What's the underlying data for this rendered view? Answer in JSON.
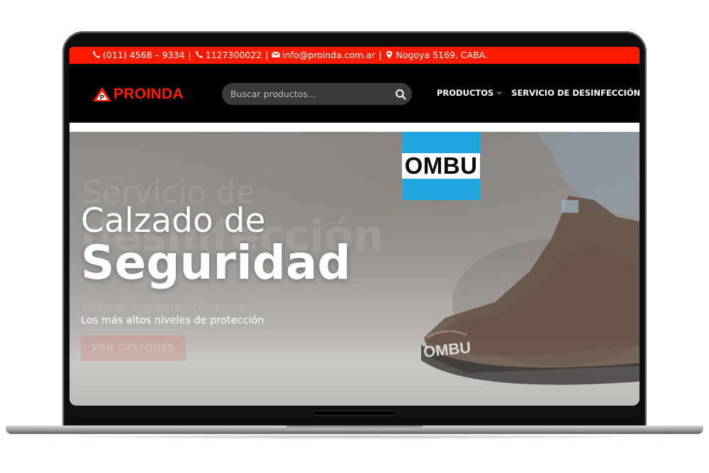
{
  "topbar": {
    "phone1": "(011) 4568 – 9334",
    "phone2": "1127300022",
    "email": "info@proinda.com.ar",
    "address": "Nogoya 5169, CABA.",
    "separator": "|"
  },
  "header": {
    "logo_text": "PROINDA",
    "logo_badge": "P",
    "search_placeholder": "Buscar productos...",
    "menu": [
      {
        "label": "PRODUCTOS",
        "has_dropdown": true
      },
      {
        "label": "SERVICIO DE DESINFECCIÓN",
        "has_dropdown": false
      }
    ]
  },
  "hero": {
    "title_line1": "Calzado de",
    "title_line2": "Seguridad",
    "subtitle": "Los más altos niveles de protección",
    "brand_badge": "OMBU",
    "ghost": {
      "line1": "Servicio de",
      "line2": "desinfección",
      "sub": "Hogares, industrias, comercios",
      "button": "VER OPCIONES"
    }
  },
  "colors": {
    "accent_red": "#ff1a00",
    "nav_bg": "#000000",
    "search_bg": "#3a3a3a",
    "ombu_blue": "#1fa6e0"
  }
}
